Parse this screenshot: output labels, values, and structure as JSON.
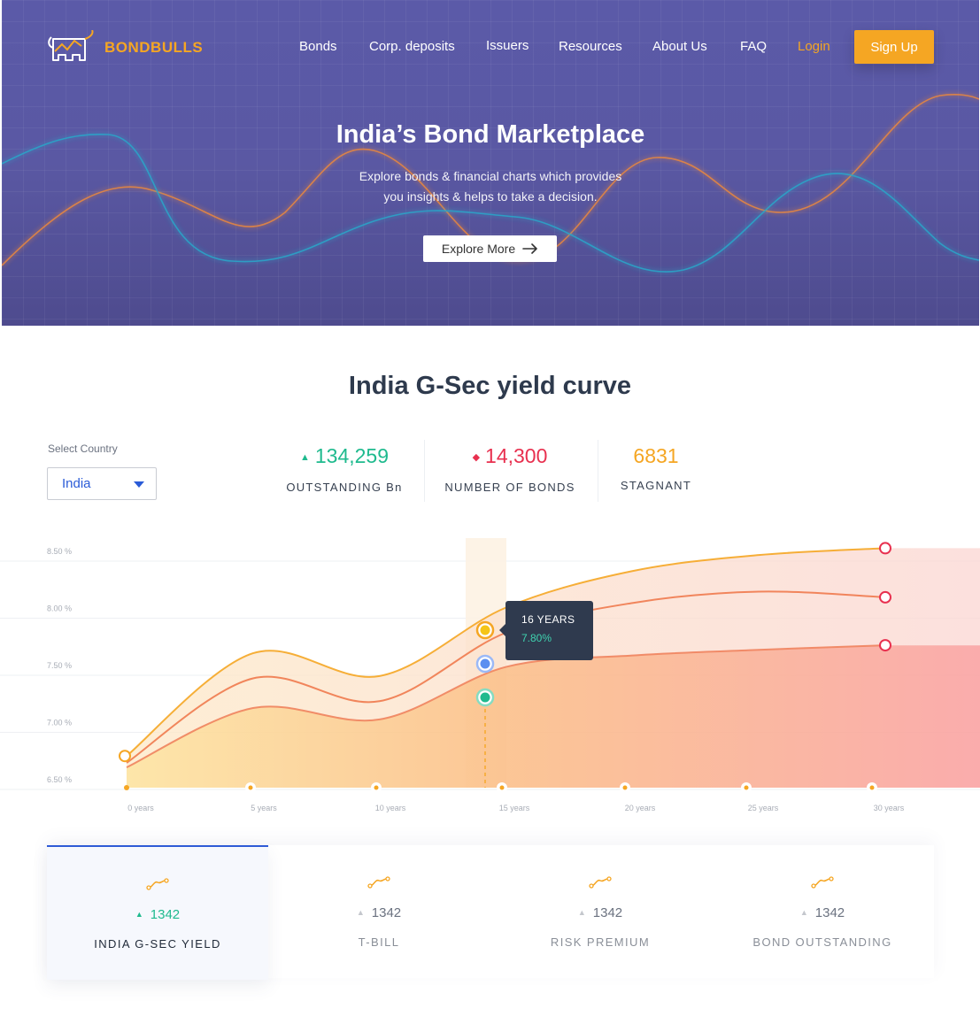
{
  "brand": {
    "name": "BONDBULLS"
  },
  "nav": {
    "items": [
      "Bonds",
      "Corp. deposits",
      "Issuers",
      "Resources",
      "About Us",
      "FAQ"
    ],
    "login": "Login",
    "signup": "Sign Up"
  },
  "hero": {
    "title": "India’s Bond Marketplace",
    "subtitle_line1": "Explore bonds & financial charts which provides",
    "subtitle_line2": "you insights & helps to take a decision.",
    "cta": "Explore More"
  },
  "section": {
    "title": "India G-Sec yield curve",
    "country_label": "Select Country",
    "country_value": "India"
  },
  "stats": [
    {
      "marker": "▲",
      "value": "134,259",
      "label": "OUTSTANDING Bn",
      "color": "#1fba8e"
    },
    {
      "marker": "◆",
      "value": "14,300",
      "label": "NUMBER OF BONDS",
      "color": "#e8304f"
    },
    {
      "marker": "",
      "value": "6831",
      "label": "STAGNANT",
      "color": "#f5a623"
    }
  ],
  "chart_data": {
    "type": "area",
    "x": [
      0,
      5,
      10,
      15,
      20,
      25,
      30
    ],
    "x_tick_labels": [
      "0 years",
      "5 years",
      "10 years",
      "15 years",
      "20 years",
      "25 years",
      "30 years"
    ],
    "y_tick_labels": [
      "8.50 %",
      "8.00 %",
      "7.50 %",
      "7.00 %",
      "6.50 %"
    ],
    "ylim": [
      6.5,
      8.5
    ],
    "series": [
      {
        "values": [
          6.7,
          7.6,
          7.4,
          8.0,
          8.32,
          8.46,
          8.52
        ],
        "color": "#f5a623"
      },
      {
        "values": [
          6.64,
          7.38,
          7.18,
          7.78,
          8.04,
          8.14,
          8.09
        ],
        "color": "#ef7a4e"
      },
      {
        "values": [
          6.6,
          7.12,
          7.02,
          7.48,
          7.58,
          7.63,
          7.67
        ],
        "color": "#f0835e"
      }
    ],
    "highlight": {
      "label": "16 YEARS",
      "value": "7.80%"
    },
    "grid": true
  },
  "cards": [
    {
      "value": "1342",
      "label": "INDIA G-SEC YIELD",
      "active": true
    },
    {
      "value": "1342",
      "label": "T-BILL",
      "active": false
    },
    {
      "value": "1342",
      "label": "RISK PREMIUM",
      "active": false
    },
    {
      "value": "1342",
      "label": "BOND OUTSTANDING",
      "active": false
    }
  ],
  "icons": {
    "card_marker": "trend-squiggle-icon",
    "arrow": "arrow-right-icon",
    "caret": "chevron-down-icon"
  },
  "colors": {
    "brand_orange": "#f5a623",
    "hero_bg": "#5a58a3",
    "positive": "#1fba8e",
    "negative": "#e8304f",
    "active_tab": "#2f5bd6"
  }
}
